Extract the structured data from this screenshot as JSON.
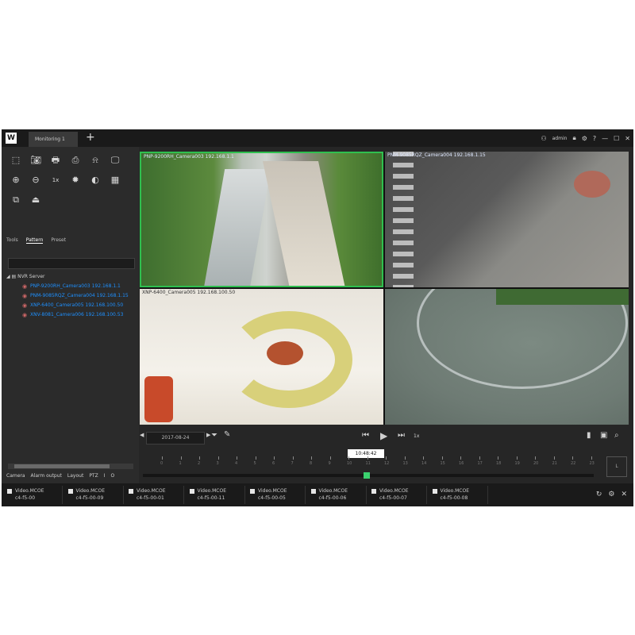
{
  "titlebar": {
    "logo": "W",
    "tab_label": "Monitoring 1",
    "add_tab": "+",
    "user": "admin"
  },
  "toolbar": {
    "rows": [
      [
        "split-icon",
        "snapshot-icon",
        "print-icon",
        "export-icon",
        "bookmark-icon",
        "monitor-icon"
      ],
      [
        "zoom-in-icon",
        "zoom-out-icon",
        "speed-1x-icon",
        "settings-icon",
        "contrast-icon",
        "grid-icon"
      ],
      [
        "sequence-icon",
        "alarm-output-icon"
      ]
    ],
    "speed_label": "1x"
  },
  "panel_tabs": [
    "Tools",
    "Pattern",
    "Preset"
  ],
  "tree": {
    "root": "NVR Server",
    "cameras": [
      "PNP-9200RH_Camera003 192.168.1.1",
      "PNM-9085RQZ_Camera004 192.168.1.15",
      "XNP-6400_Camera005 192.168.100.50",
      "XNV-8081_Camera006 192.168.100.53"
    ]
  },
  "bottom_tabs": [
    "Camera",
    "Alarm output",
    "Layout",
    "PTZ",
    "I",
    "O"
  ],
  "video": {
    "tiles": [
      {
        "label": "PNP-9200RH_Camera003 192.168.1.1"
      },
      {
        "label": "PNM-9085RQZ_Camera004 192.168.1.15"
      },
      {
        "label": "XNP-6400_Camera005 192.168.100.50"
      },
      {
        "label": ""
      }
    ],
    "selected_tile": 1
  },
  "controls": {
    "date": "2017-08-24",
    "speed": "1x"
  },
  "timeline": {
    "current_time": "10:48:42",
    "hours": [
      "0",
      "1",
      "2",
      "3",
      "4",
      "5",
      "6",
      "7",
      "8",
      "9",
      "10",
      "11",
      "12",
      "13",
      "14",
      "15",
      "16",
      "17",
      "18",
      "19",
      "20",
      "21",
      "22",
      "23"
    ]
  },
  "fit_button": "L",
  "bottom_items": [
    {
      "line1": "Video.MCOE",
      "line2": "c4-f5-00"
    },
    {
      "line1": "Video.MCOE",
      "line2": "c4-f5-00-09"
    },
    {
      "line1": "Video.MCOE",
      "line2": "c4-f5-00-01"
    },
    {
      "line1": "Video.MCOE",
      "line2": "c4-f5-00-11"
    },
    {
      "line1": "Video.MCOE",
      "line2": "c4-f5-00-05"
    },
    {
      "line1": "Video.MCOE",
      "line2": "c4-f5-00-06"
    },
    {
      "line1": "Video.MCOE",
      "line2": "c4-f5-00-07"
    },
    {
      "line1": "Video.MCOE",
      "line2": "c4-f5-00-08"
    }
  ],
  "colors": {
    "app_bg": "#262626",
    "selection_border": "#2fbf4f",
    "camera_link": "#1e90ff",
    "timeline_marker": "#3bd16f"
  }
}
